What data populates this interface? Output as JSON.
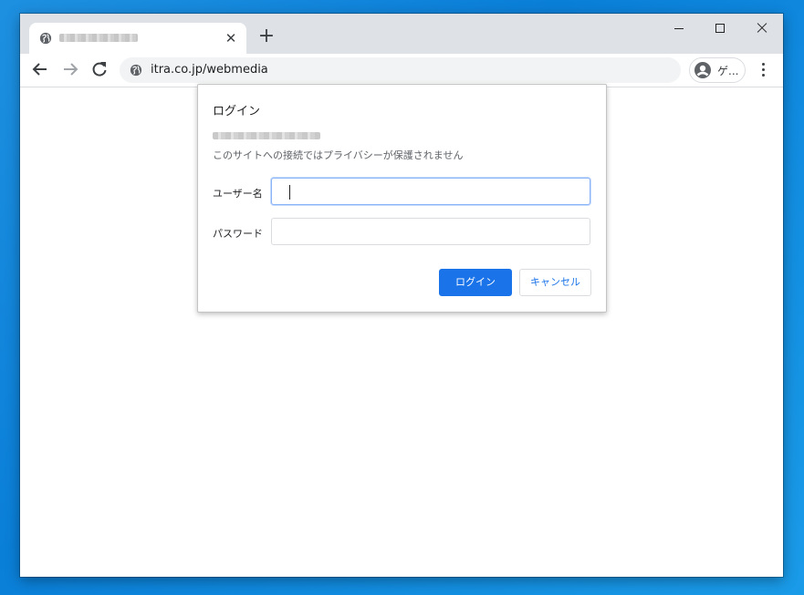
{
  "browser": {
    "tab": {
      "title_obscured": "",
      "close_glyph": "✕"
    },
    "new_tab_glyph": "+",
    "address_bar": {
      "url": "itra.co.jp/webmedia"
    },
    "profile": {
      "label": "ゲ..."
    }
  },
  "dialog": {
    "title": "ログイン",
    "origin_obscured": "",
    "warning": "このサイトへの接続ではプライバシーが保護されません",
    "username_label": "ユーザー名",
    "username_value": "",
    "password_label": "パスワード",
    "password_value": "",
    "login_button": "ログイン",
    "cancel_button": "キャンセル"
  },
  "colors": {
    "desktop": "#0a7fd8",
    "accent": "#1a73e8",
    "tabstrip": "#dee1e6",
    "omnibox": "#f1f3f4"
  },
  "icons": [
    "globe-icon",
    "close-icon",
    "plus-icon",
    "minimize-icon",
    "maximize-icon",
    "window-close-icon",
    "back-arrow-icon",
    "forward-arrow-icon",
    "reload-icon",
    "avatar-icon",
    "more-vert-icon"
  ]
}
